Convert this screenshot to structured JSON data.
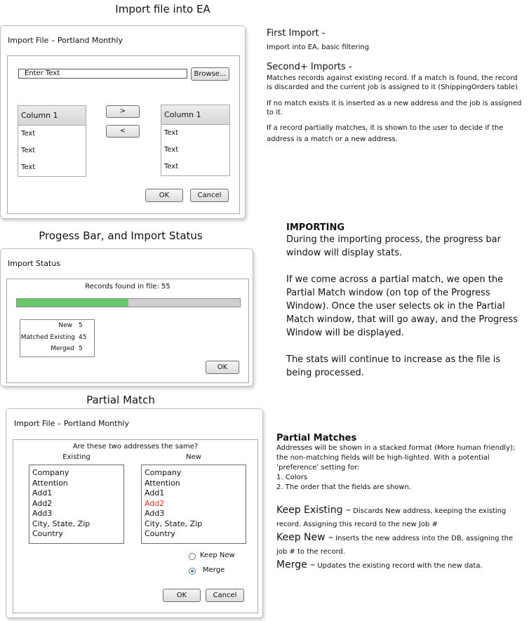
{
  "headings": {
    "import_file": "Import file into EA",
    "progress": "Progess Bar, and Import Status",
    "partial": "Partial Match"
  },
  "import_window": {
    "title": "Import File – Portland Monthly",
    "text_field_value": "Enter Text",
    "browse_label": "Browse...",
    "left_list": {
      "header": "Column 1",
      "items": [
        "Text",
        "Text",
        "Text"
      ]
    },
    "right_list": {
      "header": "Column 1",
      "items": [
        "Text",
        "Text",
        "Text"
      ]
    },
    "move_right_label": ">",
    "move_left_label": "<",
    "ok_label": "OK",
    "cancel_label": "Cancel"
  },
  "status_window": {
    "title": "Import Status",
    "records_found": "Records found in file: 55",
    "progress_fraction": 0.5,
    "stats": [
      {
        "label": "New",
        "value": "5"
      },
      {
        "label": "Matched Existing",
        "value": "45"
      },
      {
        "label": "Merged",
        "value": "5"
      }
    ],
    "ok_label": "OK"
  },
  "partial_window": {
    "title": "Import File – Portland Monthly",
    "question": "Are these two addresses the same?",
    "existing_label": "Existing",
    "new_label": "New",
    "existing_fields": [
      "Company",
      "Attention",
      "Add1",
      "Add2",
      "Add3",
      "City, State, Zip",
      "Country"
    ],
    "new_fields": [
      "Company",
      "Attention",
      "Add1",
      "Add2",
      "Add3",
      "City, State, Zip",
      "Country"
    ],
    "highlight_color": "#e0302a",
    "keep_new_label": "Keep New",
    "merge_label": "Merge",
    "ok_label": "OK",
    "cancel_label": "Cancel"
  },
  "notes_import": {
    "first_heading": "First Import -",
    "first_text": "Import into EA, basic filtering",
    "second_heading": "Second+ Imports -",
    "second_p1": "Matches records against existing record. If a match is found, the record is discarded and the current job is assigned to it (ShippingOrders table)",
    "second_p2": "If no match exists it is inserted as a new address and the job is assigned to it.",
    "second_p3": "If a record partially matches, it is shown to the user to decide if the address is a match or a new address."
  },
  "notes_importing": {
    "heading": "IMPORTING",
    "p1": "During the importing process, the progress bar window will display stats.",
    "p2": "If we come across a partial match, we open the Partial Match window (on top of the Progress Window). Once the user selects ok in the Partial Match window, that will go away, and the Progress Window will be displayed.",
    "p3": "The stats will continue to increase as the file is being processed."
  },
  "notes_partial": {
    "heading": "Partial Matches",
    "intro": "Addresses will be shown in a stacked format (More human friendly); the non-matching fields will be high-lighted. With a potential ‘preference’ setting for:",
    "item1": "1. Colors",
    "item2": "2. The order that the fields are shown.",
    "keep_existing_term": "Keep Existing –",
    "keep_existing_text": " Discards New address, keeping the existing record. Assigning this record to the new Job #",
    "keep_new_term": "Keep New –",
    "keep_new_text": " Inserts the new address into the DB, assigning the job # to the record.",
    "merge_term": "Merge –",
    "merge_text": " Updates the existing record with the new data."
  },
  "colors": {
    "progress_fill": "#66c86a",
    "progress_track": "#cfcfcf"
  }
}
